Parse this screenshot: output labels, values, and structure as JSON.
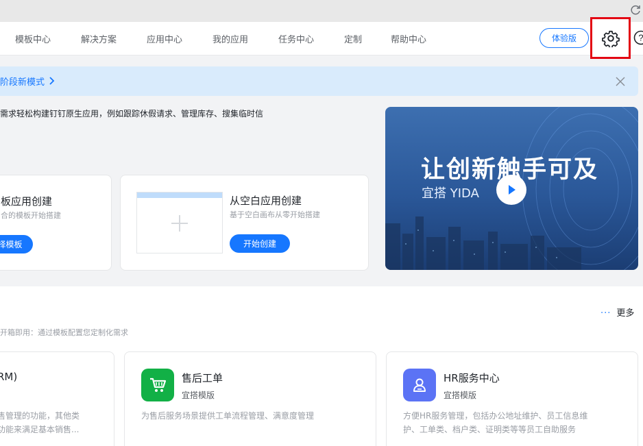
{
  "nav": {
    "items": [
      "模板中心",
      "解决方案",
      "应用中心",
      "我的应用",
      "任务中心",
      "定制",
      "帮助中心"
    ],
    "trial_button": "体验版"
  },
  "banner": {
    "text": "阶段新模式",
    "bg_color": "#d9ebfc"
  },
  "intro": {
    "description": "需求轻松构建钉钉原生应用，例如跟踪休假请求、管理库存、搜集临时信"
  },
  "create_cards": {
    "template": {
      "title": "板应用创建",
      "subtitle": "合的模板开始搭建",
      "button": "择模板"
    },
    "blank": {
      "title": "从空白应用创建",
      "subtitle": "基于空白画布从零开始搭建",
      "button": "开始创建"
    }
  },
  "video": {
    "title": "让创新触手可及",
    "subtitle": "宜搭 YIDA"
  },
  "templates": {
    "more_label": "更多",
    "description": "开箱即用：通过模板配置您定制化需求",
    "items": [
      {
        "title": "RM)",
        "desc_line1": "售管理的功能，其他类",
        "desc_line2": "功能来满足基本销售..."
      },
      {
        "title": "售后工单",
        "subtitle": "宜搭模版",
        "desc_line1": "为售后服务场景提供工单流程管理、满意度管理",
        "icon": "shopping-cart-icon",
        "icon_color": "#12b046"
      },
      {
        "title": "HR服务中心",
        "subtitle": "宜搭模版",
        "desc_line1": "方便HR服务管理，包括办公地址维护、员工信息维",
        "desc_line2": "护、工单类、档户类、证明类等等员工自助服务",
        "icon": "user-badge-icon",
        "icon_color": "#5b73f5"
      }
    ]
  },
  "colors": {
    "primary": "#1677ff",
    "highlight_box": "#e30613"
  }
}
